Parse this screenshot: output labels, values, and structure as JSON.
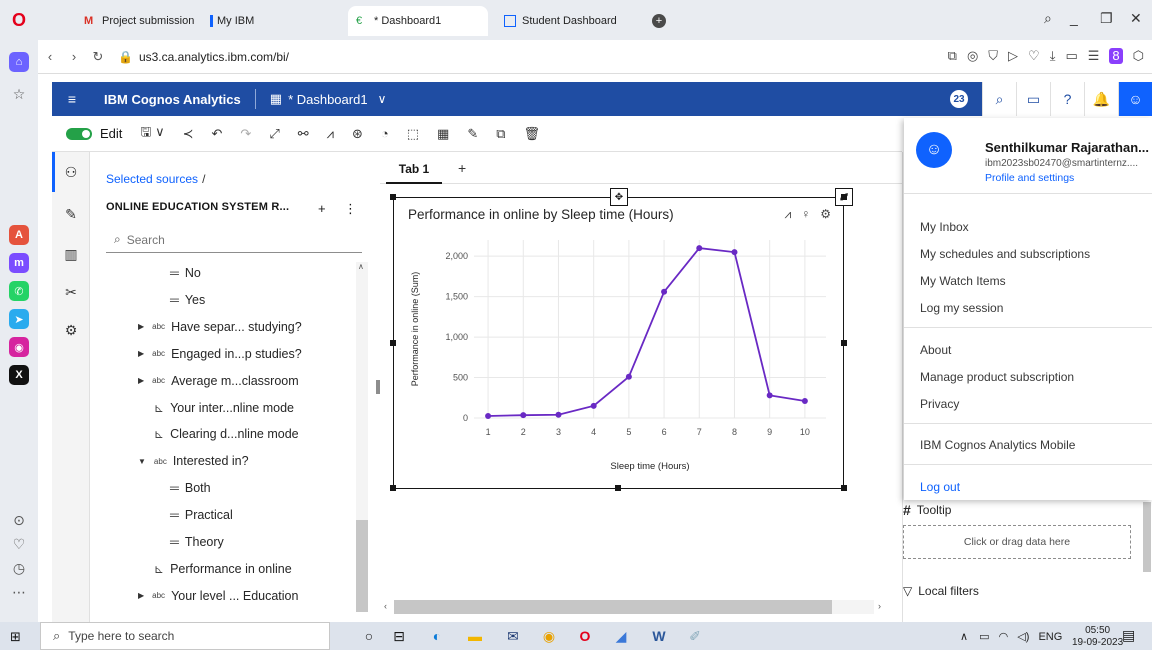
{
  "browser": {
    "tabs": [
      {
        "label": "Project submission Extend",
        "icon": "gmail-icon"
      },
      {
        "label": "My IBM",
        "icon": "ibm-icon"
      },
      {
        "label": "* Dashboard1",
        "icon": "cognos-icon"
      },
      {
        "label": "Student Dashboard",
        "icon": "dashboard-icon"
      }
    ],
    "url": "us3.ca.analytics.ibm.com/bi/"
  },
  "header": {
    "brand": "IBM Cognos Analytics",
    "dashboard_name": "* Dashboard1",
    "notification_count": "23"
  },
  "toolbar": {
    "edit_label": "Edit"
  },
  "sources": {
    "breadcrumb": "Selected sources",
    "source_name": "ONLINE EDUCATION SYSTEM R...",
    "search_placeholder": "Search",
    "tree": [
      {
        "label": "No",
        "type": "member"
      },
      {
        "label": "Yes",
        "type": "member"
      },
      {
        "label": "Have separ... studying?",
        "type": "attribute"
      },
      {
        "label": "Engaged in...p studies?",
        "type": "attribute"
      },
      {
        "label": "Average m...classroom",
        "type": "attribute"
      },
      {
        "label": "Your inter...nline mode",
        "type": "measure"
      },
      {
        "label": "Clearing d...nline mode",
        "type": "measure"
      },
      {
        "label": "Interested in?",
        "type": "attribute-open"
      },
      {
        "label": "Both",
        "type": "member"
      },
      {
        "label": "Practical",
        "type": "member"
      },
      {
        "label": "Theory",
        "type": "member"
      },
      {
        "label": "Performance in online",
        "type": "measure"
      },
      {
        "label": "Your level ... Education",
        "type": "attribute"
      }
    ]
  },
  "canvas": {
    "tab_label": "Tab 1",
    "add_tab": "+"
  },
  "chart_data": {
    "type": "line",
    "title": "Performance in online by Sleep time (Hours)",
    "xlabel": "Sleep time (Hours)",
    "ylabel": "Performance in online (Sum)",
    "x": [
      1,
      2,
      3,
      4,
      5,
      6,
      7,
      8,
      9,
      10
    ],
    "values": [
      25,
      35,
      40,
      150,
      510,
      1560,
      2100,
      2050,
      280,
      210
    ],
    "yticks": [
      "0",
      "500",
      "1,000",
      "1,500",
      "2,000"
    ],
    "ylim": [
      0,
      2200
    ],
    "xlim": [
      0.6,
      10.6
    ],
    "grid": true,
    "color": "#6929c4"
  },
  "properties": {
    "tooltip_label": "Tooltip",
    "dropzone_text": "Click or drag data here",
    "local_filters": "Local filters"
  },
  "profile_menu": {
    "user_name": "Senthilkumar Rajarathan...",
    "email": "ibm2023sb02470@smartinternz....",
    "profile_link": "Profile and settings",
    "items": [
      "My Inbox",
      "My schedules and subscriptions",
      "My Watch Items",
      "Log my session",
      "About",
      "Manage product subscription",
      "Privacy",
      "IBM Cognos Analytics Mobile",
      "Log out"
    ]
  },
  "taskbar": {
    "search_placeholder": "Type here to search",
    "lang": "ENG",
    "time": "05:50",
    "date": "19-09-2023"
  },
  "colors": {
    "header_blue": "#1f4da3",
    "accent": "#0f62fe",
    "line": "#6929c4"
  }
}
